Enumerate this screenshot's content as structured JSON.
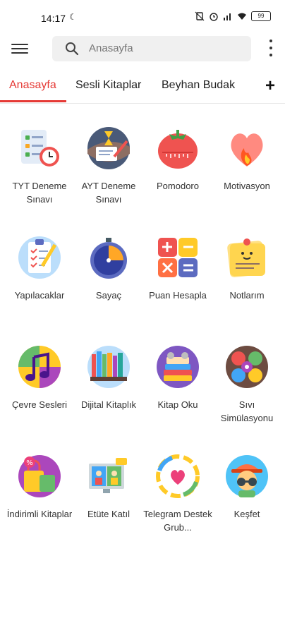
{
  "status": {
    "time": "14:17",
    "battery": "99"
  },
  "search": {
    "placeholder": "Anasayfa"
  },
  "tabs": [
    {
      "label": "Anasayfa",
      "active": true
    },
    {
      "label": "Sesli Kitaplar"
    },
    {
      "label": "Beyhan Budak"
    }
  ],
  "add_tab_label": "+",
  "colors": {
    "accent": "#e53935"
  },
  "items": [
    {
      "label": "TYT Deneme Sınavı",
      "icon": "exam-clock-icon"
    },
    {
      "label": "AYT Deneme Sınavı",
      "icon": "hourglass-exam-icon"
    },
    {
      "label": "Pomodoro",
      "icon": "tomato-timer-icon"
    },
    {
      "label": "Motivasyon",
      "icon": "heart-flame-icon"
    },
    {
      "label": "Yapılacaklar",
      "icon": "checklist-icon"
    },
    {
      "label": "Sayaç",
      "icon": "stopwatch-icon"
    },
    {
      "label": "Puan Hesapla",
      "icon": "calculator-icon"
    },
    {
      "label": "Notlarım",
      "icon": "sticky-note-icon"
    },
    {
      "label": "Çevre Sesleri",
      "icon": "music-note-icon"
    },
    {
      "label": "Dijital Kitaplık",
      "icon": "bookshelf-icon"
    },
    {
      "label": "Kitap Oku",
      "icon": "book-stack-icon"
    },
    {
      "label": "Sıvı Simülasyonu",
      "icon": "fluid-icon"
    },
    {
      "label": "İndirimli Kitaplar",
      "icon": "discount-bag-icon"
    },
    {
      "label": "Etüte Katıl",
      "icon": "video-call-icon"
    },
    {
      "label": "Telegram Destek Grub...",
      "icon": "heart-hands-icon"
    },
    {
      "label": "Keşfet",
      "icon": "explorer-icon"
    }
  ]
}
